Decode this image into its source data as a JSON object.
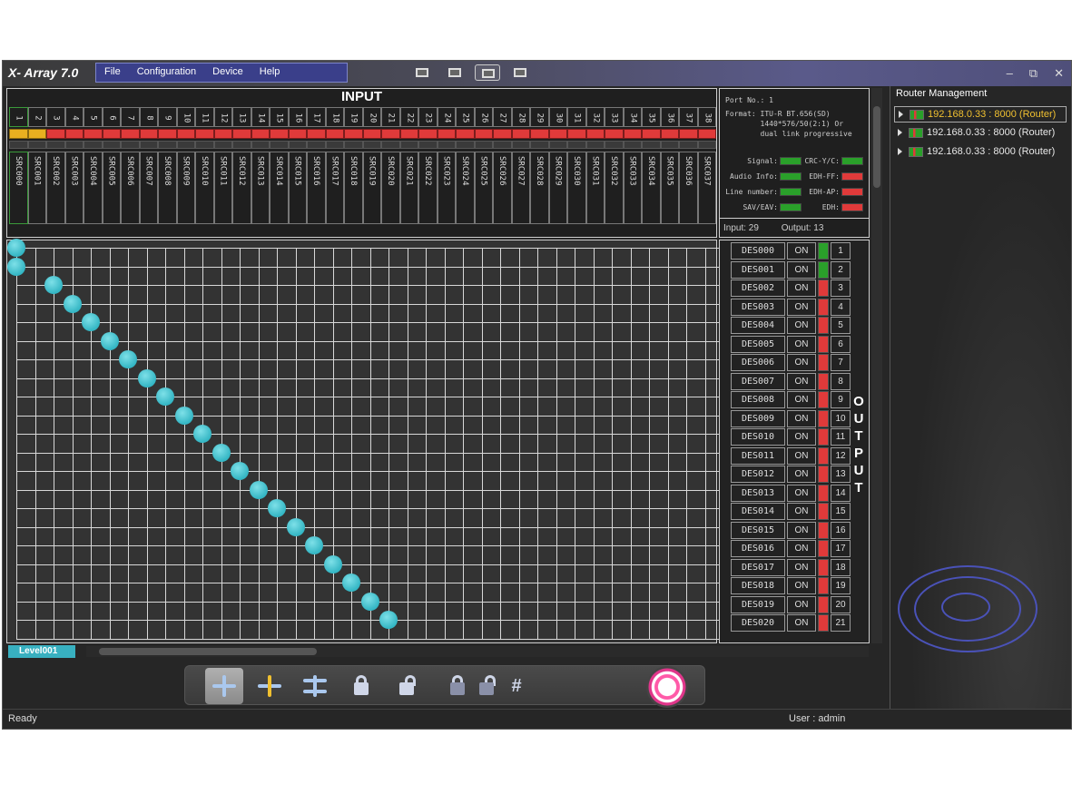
{
  "app": {
    "title": "X- Array 7.0"
  },
  "menu": [
    "File",
    "Configuration",
    "Device",
    "Help"
  ],
  "window_controls": {
    "minimize": "–",
    "restore": "⧉",
    "close": "✕"
  },
  "input": {
    "title": "INPUT",
    "count": 38,
    "yellow_status": [
      1,
      2
    ],
    "selected": 1
  },
  "info": {
    "port": "Port No.: 1",
    "format": "Format: ITU-R BT.656(SD)\n        1440*576/50(2:1) Or\n        dual link progressive",
    "signals": [
      {
        "label": "Signal:",
        "state": "green"
      },
      {
        "label": "CRC-Y/C:",
        "state": "green"
      },
      {
        "label": "Audio Info:",
        "state": "green"
      },
      {
        "label": "EDH-FF:",
        "state": "red"
      },
      {
        "label": "Line number:",
        "state": "green"
      },
      {
        "label": "EDH-AP:",
        "state": "red"
      },
      {
        "label": "SAV/EAV:",
        "state": "green"
      },
      {
        "label": "EDH:",
        "state": "red"
      }
    ],
    "input_count": "Input: 29",
    "output_count": "Output: 13"
  },
  "matrix": {
    "connections": [
      [
        1,
        1
      ],
      [
        1,
        2
      ],
      [
        3,
        3
      ],
      [
        4,
        4
      ],
      [
        5,
        5
      ],
      [
        6,
        6
      ],
      [
        7,
        7
      ],
      [
        8,
        8
      ],
      [
        9,
        9
      ],
      [
        10,
        10
      ],
      [
        11,
        11
      ],
      [
        12,
        12
      ],
      [
        13,
        13
      ],
      [
        14,
        14
      ],
      [
        15,
        15
      ],
      [
        16,
        16
      ],
      [
        17,
        17
      ],
      [
        18,
        18
      ],
      [
        19,
        19
      ],
      [
        20,
        20
      ],
      [
        21,
        21
      ]
    ]
  },
  "output": {
    "label": "OUTPUT",
    "status_text": "ON",
    "green_rows": [
      1,
      2
    ],
    "count": 21
  },
  "level_tab": "Level001",
  "toolbar": [
    "crosspoint-mode",
    "add-mode",
    "multi-mode",
    "lock",
    "unlock",
    "lock-all",
    "unlock-all",
    "grid"
  ],
  "status": {
    "text": "Ready",
    "user": "User : admin"
  },
  "router": {
    "title": "Router Management",
    "items": [
      {
        "label": "192.168.0.33 : 8000 (Router)",
        "selected": true
      },
      {
        "label": "192.168.0.33 : 8000 (Router)",
        "selected": false
      },
      {
        "label": "192.168.0.33 : 8000 (Router)",
        "selected": false
      }
    ]
  }
}
